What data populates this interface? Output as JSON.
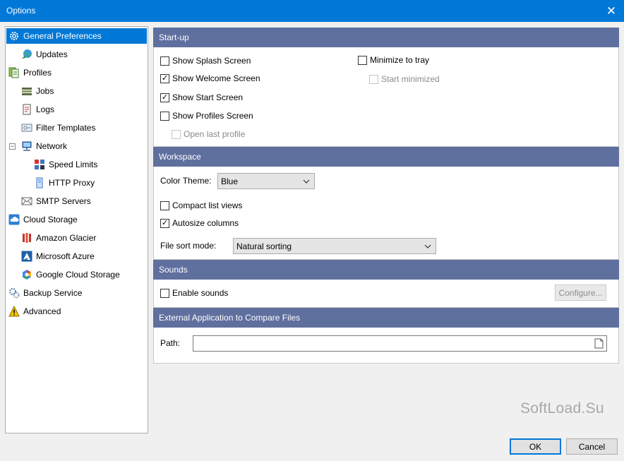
{
  "window": {
    "title": "Options",
    "close_glyph": "✕"
  },
  "tree": {
    "items": [
      {
        "label": "General Preferences",
        "icon": "gear-icon"
      },
      {
        "label": "Updates",
        "icon": "globe-update-icon"
      },
      {
        "label": "Profiles",
        "icon": "profiles-icon"
      },
      {
        "label": "Jobs",
        "icon": "jobs-icon"
      },
      {
        "label": "Logs",
        "icon": "logs-icon"
      },
      {
        "label": "Filter Templates",
        "icon": "filter-icon"
      },
      {
        "label": "Network",
        "icon": "network-icon"
      },
      {
        "label": "Speed Limits",
        "icon": "speed-icon"
      },
      {
        "label": "HTTP Proxy",
        "icon": "proxy-icon"
      },
      {
        "label": "SMTP Servers",
        "icon": "mail-icon"
      },
      {
        "label": "Cloud Storage",
        "icon": "cloud-icon"
      },
      {
        "label": "Amazon Glacier",
        "icon": "amazon-icon"
      },
      {
        "label": "Microsoft Azure",
        "icon": "azure-icon"
      },
      {
        "label": "Google Cloud Storage",
        "icon": "google-cloud-icon"
      },
      {
        "label": "Backup Service",
        "icon": "service-gear-icon"
      },
      {
        "label": "Advanced",
        "icon": "warning-icon"
      }
    ],
    "network_expander": "−"
  },
  "startup": {
    "header": "Start-up",
    "show_splash": {
      "label": "Show Splash Screen",
      "checked": false
    },
    "show_welcome": {
      "label": "Show Welcome Screen",
      "checked": true
    },
    "show_start": {
      "label": "Show Start Screen",
      "checked": true
    },
    "show_profiles": {
      "label": "Show Profiles Screen",
      "checked": false
    },
    "open_last_profile": {
      "label": "Open last profile",
      "checked": false,
      "enabled": false
    },
    "minimize_to_tray": {
      "label": "Minimize to tray",
      "checked": false
    },
    "start_minimized": {
      "label": "Start minimized",
      "checked": false,
      "enabled": false
    }
  },
  "workspace": {
    "header": "Workspace",
    "color_theme_label": "Color Theme:",
    "color_theme_value": "Blue",
    "compact_list": {
      "label": "Compact list views",
      "checked": false
    },
    "autosize_columns": {
      "label": "Autosize columns",
      "checked": true
    },
    "file_sort_label": "File sort mode:",
    "file_sort_value": "Natural sorting"
  },
  "sounds": {
    "header": "Sounds",
    "enable_sounds": {
      "label": "Enable sounds",
      "checked": false
    },
    "configure_label": "Configure..."
  },
  "external_app": {
    "header": "External Application to Compare Files",
    "path_label": "Path:",
    "path_value": ""
  },
  "footer": {
    "ok_label": "OK",
    "cancel_label": "Cancel"
  },
  "watermark": "SoftLoad.Su",
  "colors": {
    "titlebar": "#0078d7",
    "selection": "#0078d7",
    "section_header": "#5f6f9e"
  }
}
